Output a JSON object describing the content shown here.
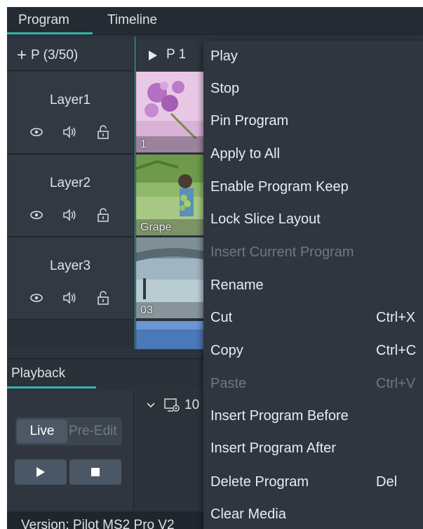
{
  "tabs": {
    "program": "Program",
    "timeline": "Timeline"
  },
  "layers": {
    "add_program": "P (3/50)",
    "items": [
      {
        "name": "Layer1"
      },
      {
        "name": "Layer2"
      },
      {
        "name": "Layer3"
      }
    ]
  },
  "program": {
    "header": "P 1",
    "thumbnails": [
      {
        "caption": "1"
      },
      {
        "caption": "Grape"
      },
      {
        "caption": "03"
      }
    ]
  },
  "context_menu": {
    "items": [
      {
        "label": "Play",
        "shortcut": "",
        "enabled": true
      },
      {
        "label": "Stop",
        "shortcut": "",
        "enabled": true
      },
      {
        "label": "Pin Program",
        "shortcut": "",
        "enabled": true
      },
      {
        "label": "Apply to All",
        "shortcut": "",
        "enabled": true
      },
      {
        "label": "Enable Program Keep",
        "shortcut": "",
        "enabled": true
      },
      {
        "label": "Lock Slice Layout",
        "shortcut": "",
        "enabled": true
      },
      {
        "label": "Insert Current Program",
        "shortcut": "",
        "enabled": false
      },
      {
        "label": "Rename",
        "shortcut": "",
        "enabled": true
      },
      {
        "label": "Cut",
        "shortcut": "Ctrl+X",
        "enabled": true
      },
      {
        "label": "Copy",
        "shortcut": "Ctrl+C",
        "enabled": true
      },
      {
        "label": "Paste",
        "shortcut": "Ctrl+V",
        "enabled": false
      },
      {
        "label": "Insert Program Before",
        "shortcut": "",
        "enabled": true
      },
      {
        "label": "Insert Program After",
        "shortcut": "",
        "enabled": true
      },
      {
        "label": "Delete Program",
        "shortcut": "Del",
        "enabled": true
      },
      {
        "label": "Clear Media",
        "shortcut": "",
        "enabled": true
      }
    ]
  },
  "playback": {
    "tab": "Playback",
    "live": "Live",
    "pre_edit": "Pre-Edit",
    "output_label": "10"
  },
  "status": {
    "version": "Version: Pilot MS2 Pro V2"
  },
  "colors": {
    "accent": "#2fb8aa",
    "panel": "#2c333c",
    "menu": "#2f3640",
    "disabled_text": "#6d7782"
  }
}
